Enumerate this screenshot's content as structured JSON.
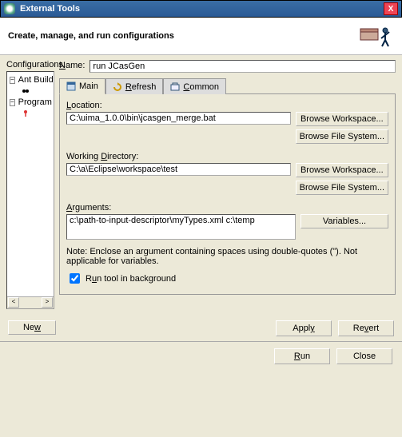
{
  "window": {
    "title": "External Tools",
    "close": "X"
  },
  "header": {
    "text": "Create, manage, and run configurations"
  },
  "tree": {
    "label": "Configurations:",
    "items": [
      "Ant Build",
      "Program"
    ],
    "scroll_left": "<",
    "scroll_right": ">"
  },
  "name": {
    "label": "Name:",
    "value": "run JCasGen"
  },
  "tabs": {
    "main": "Main",
    "refresh": "Refresh",
    "common": "Common"
  },
  "location": {
    "label": "Location:",
    "value": "C:\\uima_1.0.0\\bin\\jcasgen_merge.bat",
    "browse_ws": "Browse Workspace...",
    "browse_fs": "Browse File System..."
  },
  "workdir": {
    "label": "Working Directory:",
    "value": "C:\\a\\Eclipse\\workspace\\test",
    "browse_ws": "Browse Workspace...",
    "browse_fs": "Browse File System..."
  },
  "args": {
    "label": "Arguments:",
    "value": "c:\\path-to-input-descriptor\\myTypes.xml c:\\temp",
    "variables": "Variables..."
  },
  "note": "Note: Enclose an argument containing spaces using double-quotes (\"). Not applicable for variables.",
  "runbg": "Run tool in background",
  "buttons": {
    "new": "New",
    "apply": "Apply",
    "revert": "Revert",
    "run": "Run",
    "close": "Close"
  }
}
